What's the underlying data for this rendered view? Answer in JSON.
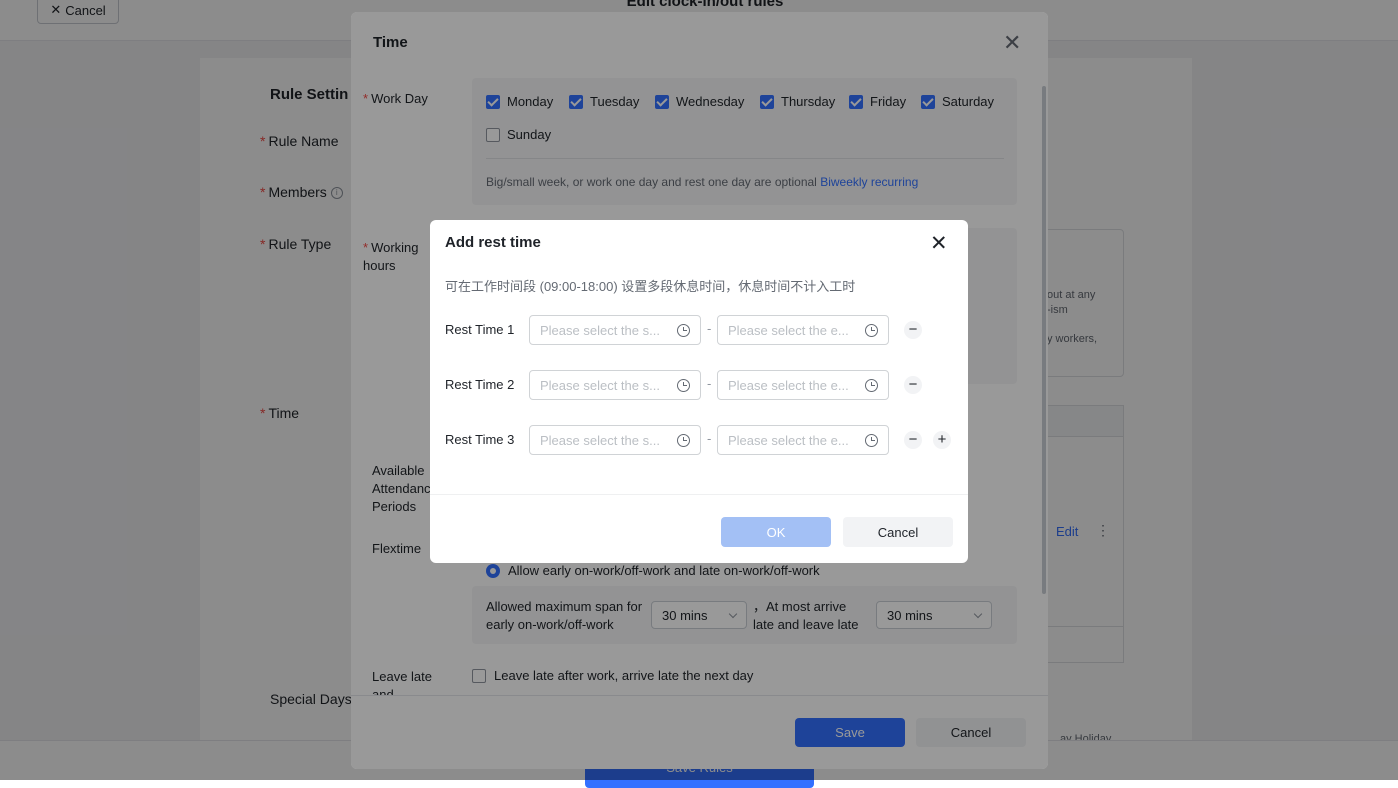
{
  "page": {
    "title": "Edit clock-in/out rules",
    "cancel_label": "Cancel",
    "rule_settings_heading": "Rule Settin",
    "rule_name_label": "Rule Name",
    "members_label": "Members",
    "rule_type_label": "Rule Type",
    "time_label": "Time",
    "special_days_label": "Special Days",
    "save_rules_label": "Save Rules",
    "right_fragments": [
      "out at any",
      "-ism",
      "y workers,"
    ],
    "right_edit_label": "Edit",
    "right_bottom_fragment": "ay Holiday"
  },
  "time_modal": {
    "title": "Time",
    "work_day_label": "Work Day",
    "days": [
      {
        "name": "Monday",
        "checked": true
      },
      {
        "name": "Tuesday",
        "checked": true
      },
      {
        "name": "Wednesday",
        "checked": true
      },
      {
        "name": "Thursday",
        "checked": true
      },
      {
        "name": "Friday",
        "checked": true
      },
      {
        "name": "Saturday",
        "checked": true
      },
      {
        "name": "Sunday",
        "checked": false
      }
    ],
    "workday_hint": "Big/small week, or work one day and rest one day are optional",
    "biweekly_link": "Biweekly recurring",
    "working_hours_label": "Working hours",
    "available_periods_label": "Available Attendance Periods",
    "flextime_label": "Flextime",
    "flex_option": "Allow early on-work/off-work and late on-work/off-work",
    "max_span_label": "Allowed maximum span for early on-work/off-work",
    "max_span_value": "30 mins",
    "at_most_label": "，At most arrive late and leave late",
    "at_most_value": "30 mins",
    "leave_late_label": "Leave late and arrival",
    "leave_late_option": "Leave late after work, arrive late the next day",
    "save_label": "Save",
    "cancel_label": "Cancel"
  },
  "rest_dialog": {
    "title": "Add rest time",
    "description": "可在工作时间段 (09:00-18:00) 设置多段休息时间，休息时间不计入工时",
    "rows": [
      {
        "label": "Rest Time 1",
        "start_placeholder": "Please select the s...",
        "end_placeholder": "Please select the e...",
        "remove": "−",
        "add": ""
      },
      {
        "label": "Rest Time 2",
        "start_placeholder": "Please select the s...",
        "end_placeholder": "Please select the e...",
        "remove": "−",
        "add": ""
      },
      {
        "label": "Rest Time 3",
        "start_placeholder": "Please select the s...",
        "end_placeholder": "Please select the e...",
        "remove": "−",
        "add": "+"
      }
    ],
    "separator": "-",
    "ok_label": "OK",
    "cancel_label": "Cancel"
  },
  "colors": {
    "accent": "#3370ff",
    "accent_disabled": "#a3c0f5",
    "required": "#f54a45",
    "overlay": "rgba(0,0,0,0.45)"
  },
  "icons": [
    "close-icon",
    "checkbox-checked-icon",
    "checkbox-unchecked-icon",
    "radio-selected-icon",
    "chevron-down-icon",
    "clock-icon",
    "minus-icon",
    "plus-icon",
    "info-icon"
  ]
}
